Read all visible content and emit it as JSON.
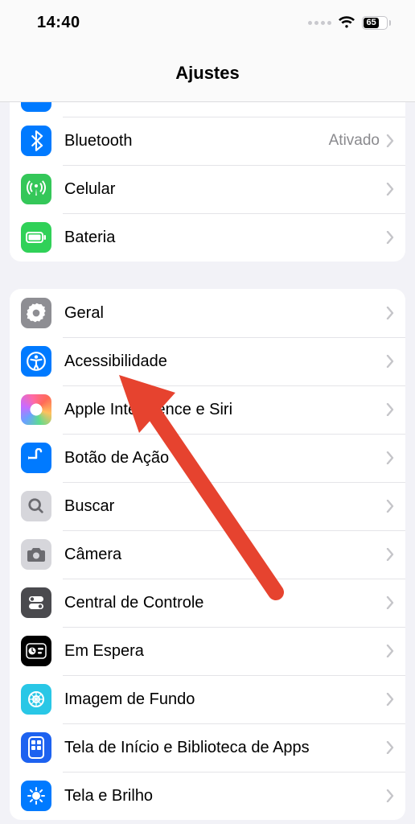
{
  "statusbar": {
    "time": "14:40",
    "battery_pct": "65"
  },
  "header": {
    "title": "Ajustes"
  },
  "group1": {
    "items": [
      {
        "label": ""
      },
      {
        "label": "Bluetooth",
        "value": "Ativado"
      },
      {
        "label": "Celular"
      },
      {
        "label": "Bateria"
      }
    ]
  },
  "group2": {
    "items": [
      {
        "label": "Geral"
      },
      {
        "label": "Acessibilidade"
      },
      {
        "label": "Apple Intelligence e Siri"
      },
      {
        "label": "Botão de Ação"
      },
      {
        "label": "Buscar"
      },
      {
        "label": "Câmera"
      },
      {
        "label": "Central de Controle"
      },
      {
        "label": "Em Espera"
      },
      {
        "label": "Imagem de Fundo"
      },
      {
        "label": "Tela de Início e Biblioteca de Apps"
      },
      {
        "label": "Tela e Brilho"
      }
    ]
  }
}
